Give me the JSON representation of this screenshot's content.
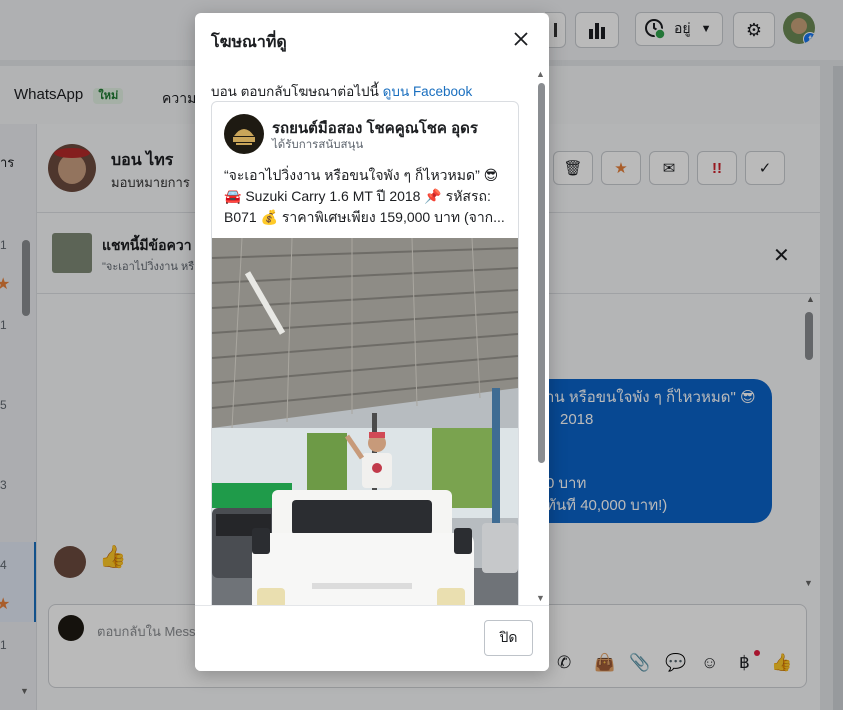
{
  "background": {
    "topbar": {
      "status_label": "อยู่"
    },
    "tabs": [
      {
        "label": "WhatsApp",
        "badge": "ใหม่"
      },
      {
        "label": "ความเ"
      }
    ],
    "left_partial_label": "าร",
    "left_counts": [
      "1",
      "1",
      "5",
      "3",
      "4",
      "1"
    ],
    "contact": {
      "name": "บอน ไทร",
      "assign": "มอบหมายการ"
    },
    "notice": {
      "title": "แชทนี้มีข้อควา",
      "preview": "\"จะเอาไปวิ่งงาน หรื"
    },
    "bubble_lines": [
      "าน หรือขนใจพัง ๆ ก็ไหวหมด\" 😎",
      "2018",
      "",
      "0 บาท",
      "ทันที 40,000 บาท!)"
    ],
    "composer_placeholder": "ตอบกลับใน Mess",
    "brand_colors": {
      "accent": "#0a63c9",
      "link": "#1a6fbf",
      "badge_bg": "#e3f1e4",
      "badge_text": "#1f7a32"
    }
  },
  "modal": {
    "title": "โฆษณาที่ดู",
    "subtitle_prefix": "บอน ตอบกลับโฆษณาต่อไปนี้",
    "subtitle_link": "ดูบน Facebook",
    "ad": {
      "page_name": "รถยนต์มือสอง โชคคูณโชค อุดร",
      "sponsored": "ได้รับการสนับสนุน",
      "text_line1": "“จะเอาไปวิ่งงาน หรือขนใจพัง ๆ ก็ไหวหมด” 😎",
      "text_line2": "🚘 Suzuki Carry 1.6 MT ปี 2018 📌 รหัสรถ:",
      "text_line3": "B071 💰 ราคาพิเศษเพียง 159,000 บาท (จาก..."
    },
    "close_label": "ปิด"
  }
}
